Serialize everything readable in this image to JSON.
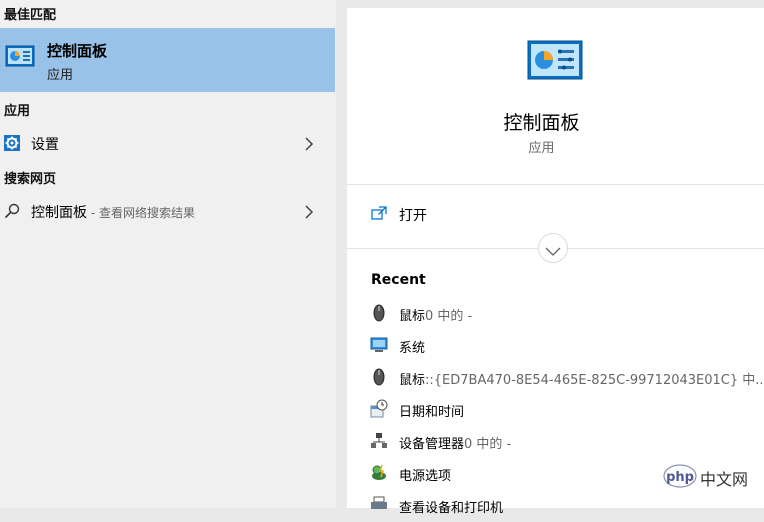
{
  "left": {
    "best_match_header": "最佳匹配",
    "best_match": {
      "title": "控制面板",
      "subtitle": "应用",
      "icon": "control-panel-icon"
    },
    "apps_header": "应用",
    "apps": [
      {
        "label": "设置",
        "icon": "gear-icon"
      }
    ],
    "web_header": "搜索网页",
    "web": [
      {
        "label": "控制面板",
        "suffix": " - 查看网络搜索结果",
        "icon": "search-icon"
      }
    ]
  },
  "right": {
    "title": "控制面板",
    "subtitle": "应用",
    "open_label": "打开",
    "recent_header": "Recent",
    "recent": [
      {
        "label": "鼠标",
        "detail": "0 中的 -",
        "icon": "mouse-icon"
      },
      {
        "label": "系统",
        "detail": "",
        "icon": "monitor-icon"
      },
      {
        "label": "鼠标",
        "detail": "::{ED7BA470-8E54-465E-825C-99712043E01C} 中...",
        "icon": "mouse-icon"
      },
      {
        "label": "日期和时间",
        "detail": "",
        "icon": "clock-calendar-icon"
      },
      {
        "label": "设备管理器",
        "detail": "0 中的 -",
        "icon": "device-manager-icon"
      },
      {
        "label": "电源选项",
        "detail": "",
        "icon": "power-options-icon"
      },
      {
        "label": "查看设备和打印机",
        "detail": "",
        "icon": "printer-icon"
      }
    ]
  },
  "watermark": {
    "text": "中文网",
    "logo_text": "php"
  },
  "colors": {
    "selected": "#99c2e8",
    "left_bg": "#f0f0f0",
    "panel_bg": "#ffffff",
    "accent": "#0078d7"
  }
}
